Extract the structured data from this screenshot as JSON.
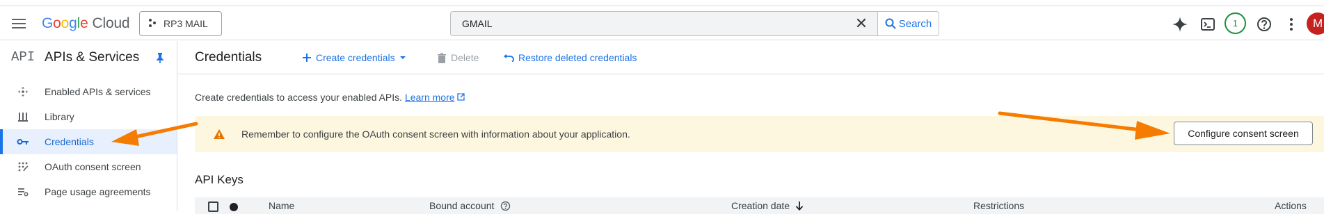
{
  "header": {
    "logo_google": "Google",
    "logo_cloud": "Cloud",
    "project_name": "RP3 MAIL",
    "search_value": "GMAIL",
    "search_label": "Search",
    "notification_count": "1",
    "avatar_letter": "M"
  },
  "sidebar": {
    "logo": "API",
    "title": "APIs & Services",
    "items": [
      {
        "label": "Enabled APIs & services",
        "icon": "diamond-arrows-icon"
      },
      {
        "label": "Library",
        "icon": "library-icon"
      },
      {
        "label": "Credentials",
        "icon": "key-icon",
        "active": true
      },
      {
        "label": "OAuth consent screen",
        "icon": "consent-icon"
      },
      {
        "label": "Page usage agreements",
        "icon": "settings-list-icon"
      }
    ]
  },
  "main": {
    "title": "Credentials",
    "toolbar": {
      "create_label": "Create credentials",
      "delete_label": "Delete",
      "restore_label": "Restore deleted credentials"
    },
    "intro_text": "Create credentials to access your enabled APIs.",
    "learn_more": "Learn more",
    "warning": {
      "text": "Remember to configure the OAuth consent screen with information about your application.",
      "button_label": "Configure consent screen"
    },
    "api_keys_heading": "API Keys",
    "table_columns": {
      "name": "Name",
      "bound_account": "Bound account",
      "creation_date": "Creation date",
      "restrictions": "Restrictions",
      "actions": "Actions"
    }
  },
  "colors": {
    "accent": "#1a73e8",
    "warning_bg": "#fef7e0",
    "annotation_arrow": "#f57c00"
  }
}
